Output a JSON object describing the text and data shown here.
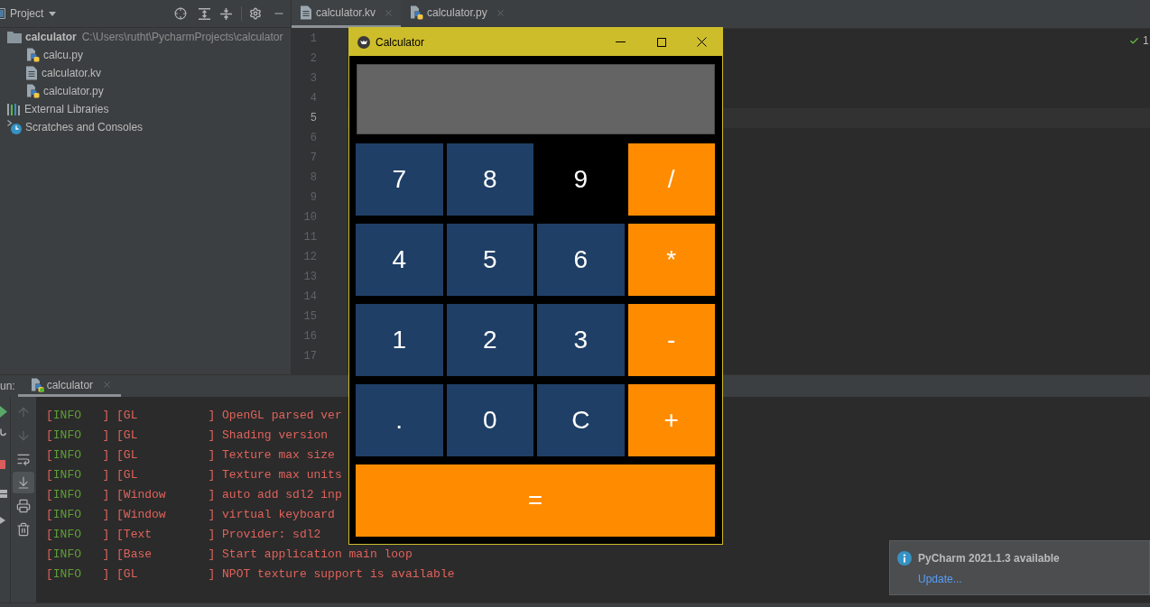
{
  "project_panel": {
    "title": "Project",
    "tree": [
      {
        "label": "calculator",
        "path": "C:\\Users\\rutht\\PycharmProjects\\calculator",
        "kind": "folder",
        "children": [
          {
            "label": "calcu.py",
            "kind": "python"
          },
          {
            "label": "calculator.kv",
            "kind": "text"
          },
          {
            "label": "calculator.py",
            "kind": "python"
          }
        ]
      },
      {
        "label": "External Libraries",
        "kind": "libraries"
      },
      {
        "label": "Scratches and Consoles",
        "kind": "scratches"
      }
    ]
  },
  "editor": {
    "tabs": [
      {
        "label": "calculator.kv",
        "kind": "text",
        "selected": true
      },
      {
        "label": "calculator.py",
        "kind": "python",
        "selected": false
      }
    ],
    "lines": [
      {
        "number": "1",
        "current": false
      },
      {
        "number": "2",
        "current": false
      },
      {
        "number": "3",
        "current": false
      },
      {
        "number": "4",
        "current": false
      },
      {
        "number": "5",
        "current": true
      },
      {
        "number": "6",
        "current": false
      },
      {
        "number": "7",
        "current": false
      },
      {
        "number": "8",
        "current": false
      },
      {
        "number": "9",
        "current": false
      },
      {
        "number": "10",
        "current": false
      },
      {
        "number": "11",
        "current": false
      },
      {
        "number": "12",
        "current": false
      },
      {
        "number": "13",
        "current": false
      },
      {
        "number": "14",
        "current": false
      },
      {
        "number": "15",
        "current": false
      },
      {
        "number": "16",
        "current": false
      },
      {
        "number": "17",
        "current": false
      }
    ],
    "problems_count": "1"
  },
  "calculator_window": {
    "title": "Calculator",
    "keys": [
      {
        "label": "7",
        "color": "#1f3f66"
      },
      {
        "label": "8",
        "color": "#1f3f66"
      },
      {
        "label": "9",
        "color": "#000000"
      },
      {
        "label": "/",
        "color": "#ff8c00"
      },
      {
        "label": "4",
        "color": "#1f3f66"
      },
      {
        "label": "5",
        "color": "#1f3f66"
      },
      {
        "label": "6",
        "color": "#1f3f66"
      },
      {
        "label": "*",
        "color": "#ff8c00"
      },
      {
        "label": "1",
        "color": "#1f3f66"
      },
      {
        "label": "2",
        "color": "#1f3f66"
      },
      {
        "label": "3",
        "color": "#1f3f66"
      },
      {
        "label": "-",
        "color": "#ff8c00"
      },
      {
        "label": ".",
        "color": "#1f3f66"
      },
      {
        "label": "0",
        "color": "#1f3f66"
      },
      {
        "label": "C",
        "color": "#1f3f66"
      },
      {
        "label": "+",
        "color": "#ff8c00"
      }
    ],
    "equals": {
      "label": "=",
      "color": "#ff8c00"
    }
  },
  "run_panel": {
    "title": "un:",
    "tabs": [
      {
        "label": "calculator",
        "selected": true
      }
    ],
    "toolbar": [
      {
        "kind": "up",
        "selected": false,
        "disabled": true
      },
      {
        "kind": "down",
        "selected": false,
        "disabled": true
      },
      {
        "kind": "wrap",
        "selected": false,
        "disabled": false
      },
      {
        "kind": "scroll_end",
        "selected": true,
        "disabled": false
      },
      {
        "kind": "print",
        "selected": false,
        "disabled": false
      },
      {
        "kind": "trash",
        "selected": false,
        "disabled": false
      }
    ],
    "console": [
      {
        "level": {
          "open": "[",
          "name": "INFO",
          "close": "   ]"
        },
        "source": "[GL          ]",
        "message": "OpenGL parsed ver"
      },
      {
        "level": {
          "open": "[",
          "name": "INFO",
          "close": "   ]"
        },
        "source": "[GL          ]",
        "message": "Shading version"
      },
      {
        "level": {
          "open": "[",
          "name": "INFO",
          "close": "   ]"
        },
        "source": "[GL          ]",
        "message": "Texture max size"
      },
      {
        "level": {
          "open": "[",
          "name": "INFO",
          "close": "   ]"
        },
        "source": "[GL          ]",
        "message": "Texture max units"
      },
      {
        "level": {
          "open": "[",
          "name": "INFO",
          "close": "   ]"
        },
        "source": "[Window      ]",
        "message": "auto add sdl2 inp"
      },
      {
        "level": {
          "open": "[",
          "name": "INFO",
          "close": "   ]"
        },
        "source": "[Window      ]",
        "message": "virtual keyboard"
      },
      {
        "level": {
          "open": "[",
          "name": "INFO",
          "close": "   ]"
        },
        "source": "[Text        ]",
        "message": "Provider: sdl2"
      },
      {
        "level": {
          "open": "[",
          "name": "INFO",
          "close": "   ]"
        },
        "source": "[Base        ]",
        "message": "Start application main loop"
      },
      {
        "level": {
          "open": "[",
          "name": "INFO",
          "close": "   ]"
        },
        "source": "[GL          ]",
        "message": "NPOT texture support is available"
      }
    ]
  },
  "notification": {
    "title": "PyCharm 2021.1.3 available",
    "link": "Update..."
  }
}
